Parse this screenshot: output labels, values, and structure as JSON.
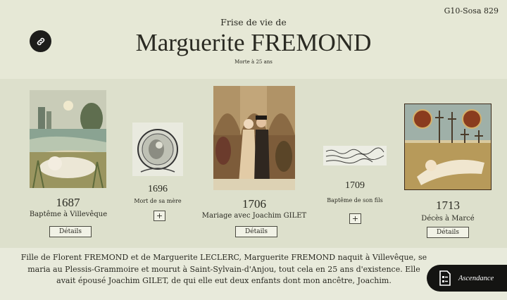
{
  "header": {
    "sosa": "G10-Sosa 829",
    "subtitle": "Frise de vie de",
    "title": "Marguerite FREMOND",
    "age_note": "Morte à 25 ans"
  },
  "timeline": [
    {
      "year": "1687",
      "label": "Baptême à Villevêque",
      "button": "Détails",
      "image": "baby-sleeping-in-landscape-painting"
    },
    {
      "year": "1696",
      "label": "Mort de sa mère",
      "button": "+",
      "image": "engraving-of-mother-and-child-in-circle"
    },
    {
      "year": "1706",
      "label": "Mariage avec Joachim GILET",
      "button": "Détails",
      "image": "medieval-wedding-painting"
    },
    {
      "year": "1709",
      "label": "Baptême de son fils",
      "button": "+",
      "image": "handwritten-parish-record"
    },
    {
      "year": "1713",
      "label": "Décès à Marcé",
      "button": "Détails",
      "image": "woman-lying-in-graveyard-painting"
    }
  ],
  "bio": "Fille de Florent FREMOND et de Marguerite LECLERC, Marguerite FREMOND naquit à Villevêque, se maria au Plessis-Grammoire et mourut à Saint-Sylvain-d'Anjou, tout cela en 25 ans d'existence. Elle avait épousé Joachim GILET, de qui elle eut deux enfants dont mon ancêtre, Joachim.",
  "ascendance_button": {
    "label": "Ascendance",
    "icon": "family-tree-document-icon"
  },
  "link_icon": "link-icon",
  "colors": {
    "background": "#e6e8d6",
    "band": "#dde0cc",
    "dark_button": "#141412"
  }
}
